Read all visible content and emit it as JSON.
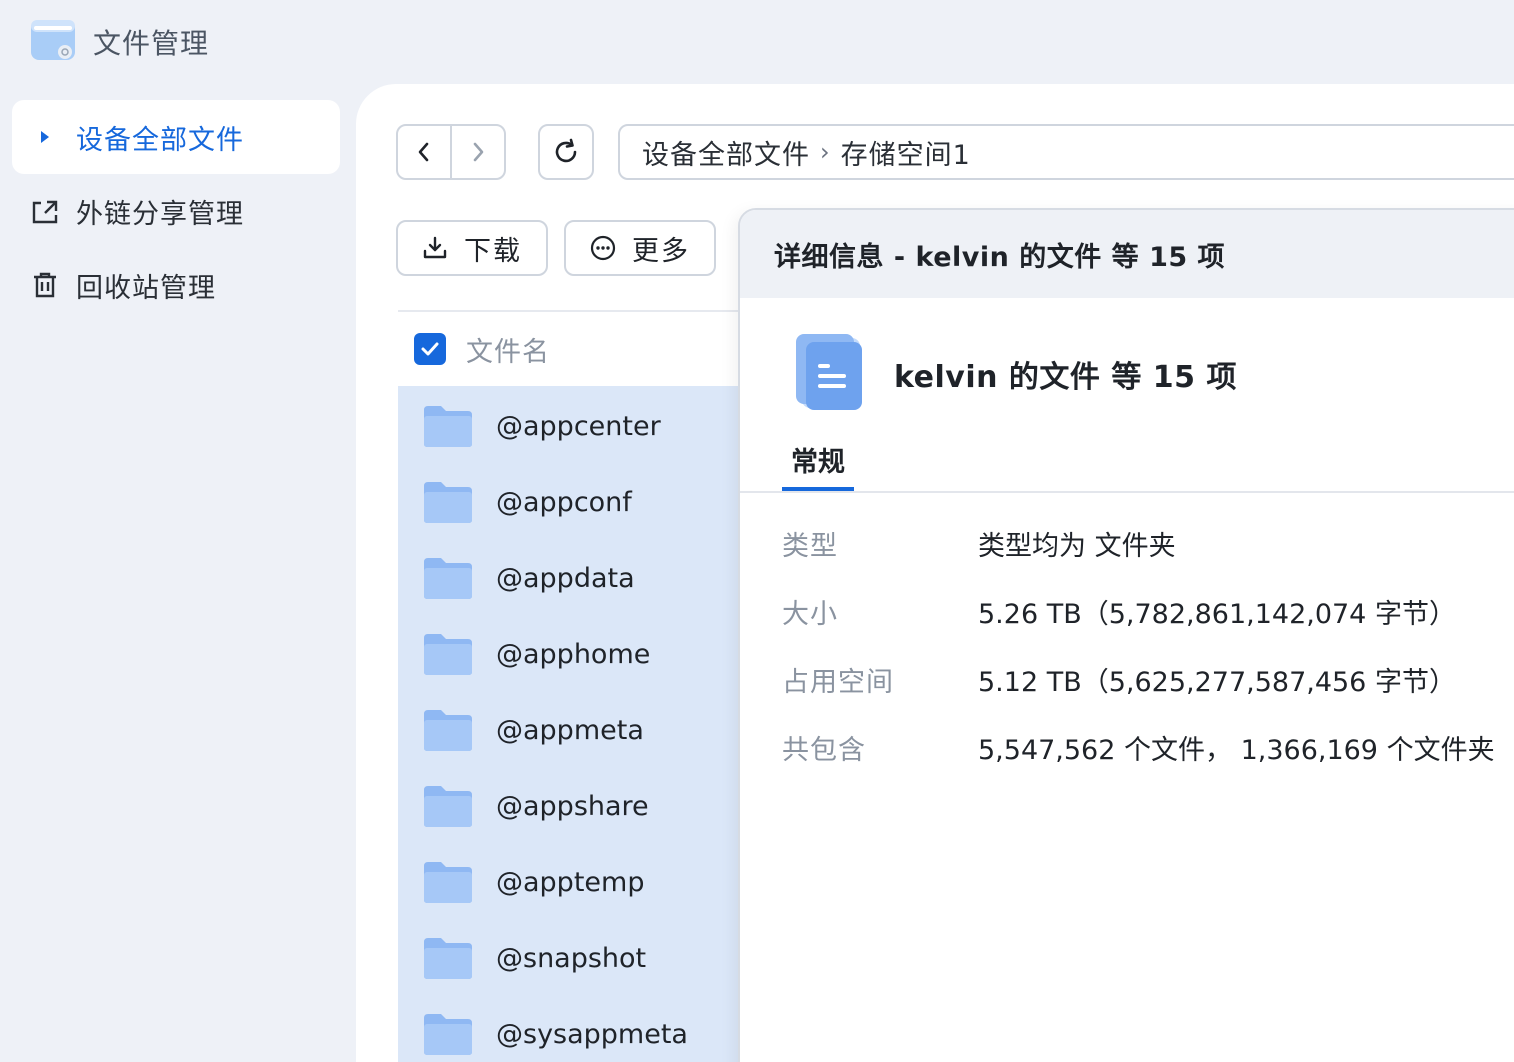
{
  "app": {
    "title": "文件管理",
    "logo_icon": "file-manager-app-icon"
  },
  "sidebar": {
    "items": [
      {
        "label": "设备全部文件",
        "icon": "caret-right-icon",
        "active": true
      },
      {
        "label": "外链分享管理",
        "icon": "share-link-icon",
        "active": false
      },
      {
        "label": "回收站管理",
        "icon": "trash-icon",
        "active": false
      }
    ]
  },
  "toolbar": {
    "breadcrumb": {
      "root": "设备全部文件",
      "current": "存储空间1"
    },
    "download_label": "下载",
    "more_label": "更多"
  },
  "file_list": {
    "header": "文件名",
    "select_all_checked": true,
    "rows": [
      "@appcenter",
      "@appconf",
      "@appdata",
      "@apphome",
      "@appmeta",
      "@appshare",
      "@apptemp",
      "@snapshot",
      "@sysappmeta"
    ]
  },
  "detail": {
    "header": "详细信息 - kelvin 的文件 等 15 项",
    "title": "kelvin 的文件 等 15 项",
    "tab": "常规",
    "props": [
      {
        "label": "类型",
        "value": "类型均为 文件夹"
      },
      {
        "label": "大小",
        "value": "5.26 TB（5,782,861,142,074 字节）"
      },
      {
        "label": "占用空间",
        "value": "5.12 TB（5,625,277,587,456 字节）"
      },
      {
        "label": "共包含",
        "value": "5,547,562 个文件，  1,366,169 个文件夹"
      }
    ]
  },
  "colors": {
    "accent": "#1668dc",
    "selection": "#dbe7f8",
    "folder": "#8fb8f3"
  }
}
